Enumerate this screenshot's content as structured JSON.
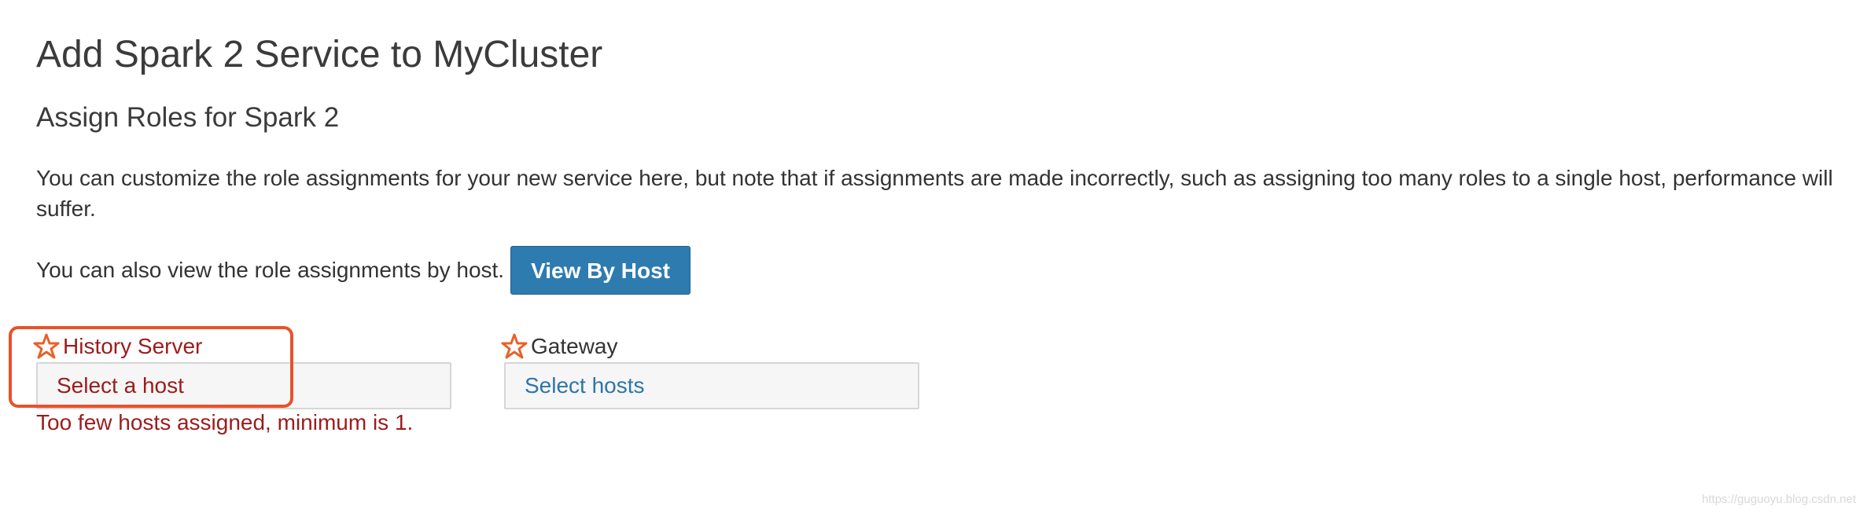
{
  "page": {
    "title": "Add Spark 2 Service to MyCluster",
    "subtitle": "Assign Roles for Spark 2",
    "description": "You can customize the role assignments for your new service here, but note that if assignments are made incorrectly, such as assigning too many roles to a single host, performance will suffer.",
    "view_by_host_text": "You can also view the role assignments by host.",
    "view_by_host_button": "View By Host"
  },
  "roles": [
    {
      "label": "History Server",
      "select_text": "Select a host",
      "icon": "star-icon",
      "state": "error"
    },
    {
      "label": "Gateway",
      "select_text": "Select hosts",
      "icon": "star-icon",
      "state": "normal"
    }
  ],
  "validation": {
    "history_server_message": "Too few hosts assigned, minimum is 1."
  },
  "watermark": "https://guguoyu.blog.csdn.net",
  "colors": {
    "primary_button": "#2e7bb0",
    "error_text": "#9b1c1c",
    "link_text": "#2e75a8",
    "highlight_border": "#e8522a",
    "star_fill": "#ffffff",
    "star_stroke": "#e8612a"
  }
}
